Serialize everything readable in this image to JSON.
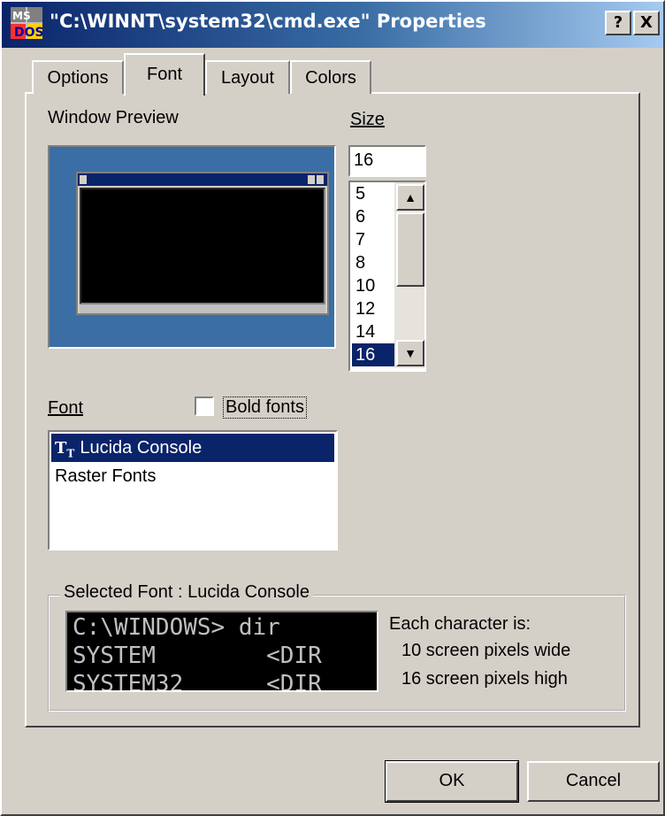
{
  "window": {
    "title": "\"C:\\WINNT\\system32\\cmd.exe\" Properties",
    "icon": "ms-dos-icon",
    "help_label": "?",
    "close_label": "X"
  },
  "tabs": [
    {
      "label": "Options",
      "active": false
    },
    {
      "label": "Font",
      "active": true
    },
    {
      "label": "Layout",
      "active": false
    },
    {
      "label": "Colors",
      "active": false
    }
  ],
  "preview": {
    "label": "Window Preview",
    "background": "#3a6ea5"
  },
  "size": {
    "label": "Size",
    "value": "16",
    "options": [
      "5",
      "6",
      "7",
      "8",
      "10",
      "12",
      "14",
      "16"
    ],
    "selected": "16"
  },
  "font": {
    "label": "Font",
    "bold_label": "Bold fonts",
    "bold_checked": false,
    "items": [
      {
        "label": "Lucida Console",
        "icon": "truetype-icon",
        "selected": true
      },
      {
        "label": "Raster Fonts",
        "icon": "",
        "selected": false
      }
    ]
  },
  "selected_font": {
    "group_label": "Selected Font : Lucida Console",
    "sample_lines": [
      "C:\\WINDOWS> dir",
      "SYSTEM        <DIR",
      "SYSTEM32      <DIR"
    ],
    "char_label": "Each character is:",
    "width_text": "10 screen pixels wide",
    "height_text": "16 screen pixels high"
  },
  "buttons": {
    "ok": "OK",
    "cancel": "Cancel"
  },
  "colors": {
    "title_start": "#0a246a",
    "title_end": "#a6caf0",
    "face": "#d4d0c8",
    "selection": "#0a246a"
  }
}
